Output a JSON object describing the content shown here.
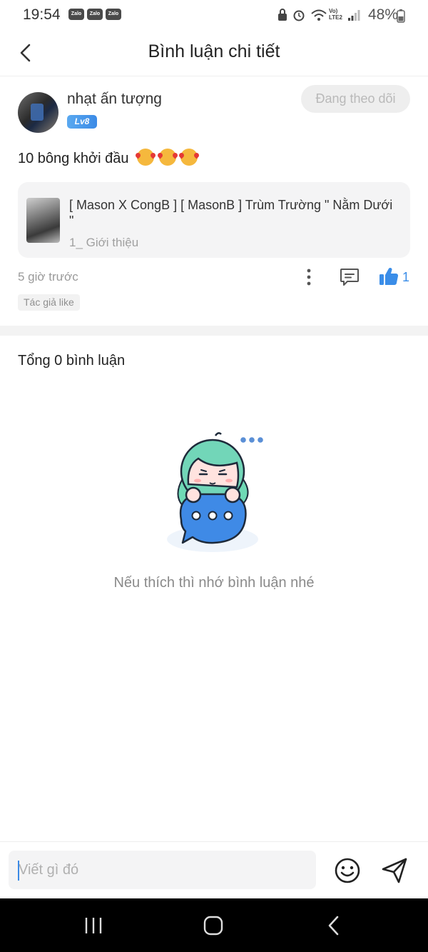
{
  "status_bar": {
    "time": "19:54",
    "notif_icons": [
      "Zalo",
      "Zalo",
      "Zalo"
    ],
    "network": "Vo) LTE2",
    "battery": "48%"
  },
  "header": {
    "title": "Bình luận chi tiết"
  },
  "post": {
    "username": "nhạt ấn tượng",
    "level": "Lv8",
    "follow_label": "Đang theo dõi",
    "text": "10 bông khởi đầu",
    "reference": {
      "title": "[ Mason X CongB ] [ MasonB ] Trùm Trường \" Nằm Dưới \"",
      "subtitle": "1_ Giới thiệu"
    },
    "time": "5 giờ trước",
    "like_count": "1",
    "tag": "Tác giả like"
  },
  "comments": {
    "total_label": "Tổng 0 bình luận",
    "empty_message": "Nếu thích thì nhớ bình luận nhé"
  },
  "input": {
    "placeholder": "Viết gì đó"
  },
  "colors": {
    "accent": "#3b8ae6",
    "muted": "#9a9a9a",
    "card_bg": "#f4f4f5"
  }
}
